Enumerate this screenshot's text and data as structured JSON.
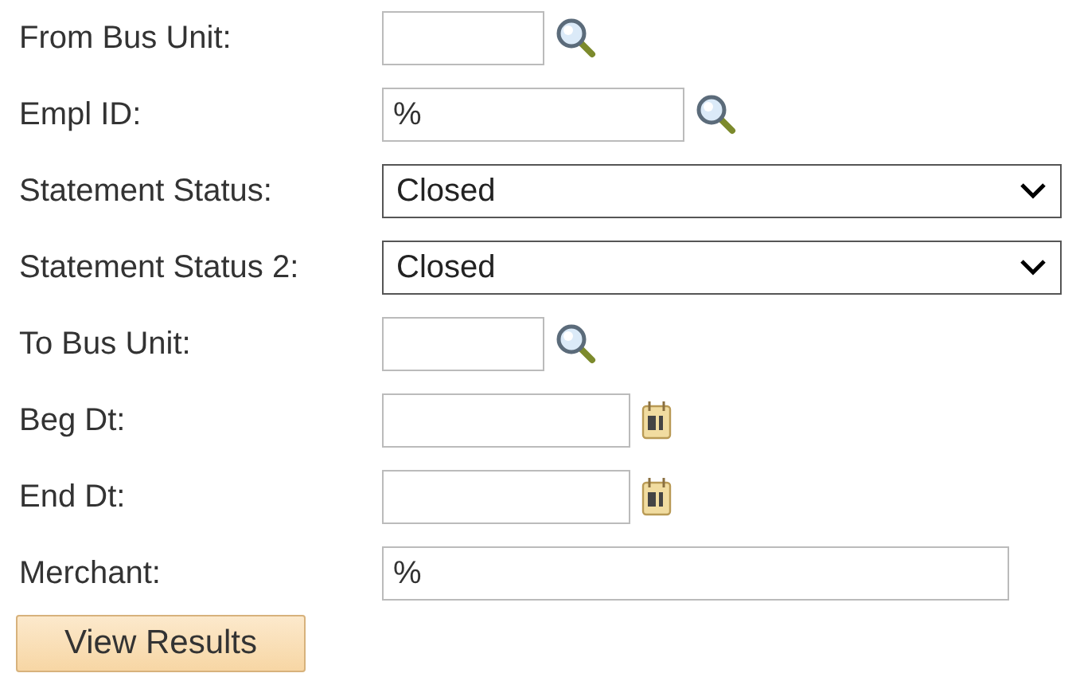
{
  "fields": [
    {
      "label": "From Bus Unit:",
      "kind": "lookup"
    },
    {
      "label": "Empl ID:",
      "kind": "lookup",
      "value": "%"
    },
    {
      "label": "Statement Status:",
      "kind": "select",
      "value": "Closed"
    },
    {
      "label": "Statement Status 2:",
      "kind": "select",
      "value": "Closed"
    },
    {
      "label": "To Bus Unit:",
      "kind": "lookup"
    },
    {
      "label": "Beg Dt:",
      "kind": "date"
    },
    {
      "label": "End Dt:",
      "kind": "date"
    },
    {
      "label": "Merchant:",
      "kind": "text",
      "value": "%"
    }
  ],
  "button": "View Results"
}
